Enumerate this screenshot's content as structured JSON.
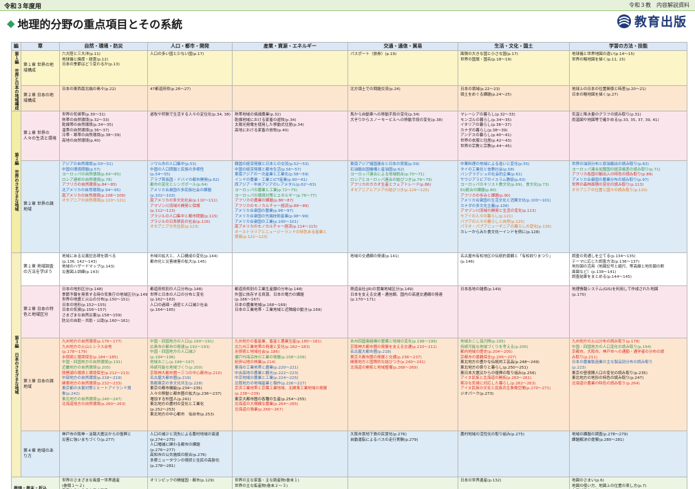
{
  "header": {
    "year_label": "令和３年度用",
    "doc_label": "令和３教　内容解説資料",
    "title": "地理的分野の重点項目とその系統",
    "title_marker": "◆",
    "publisher": "教育出版"
  },
  "columns": {
    "hen": "編",
    "sho": "章",
    "c1": "自然・環境・防災",
    "c2": "人口・都市・開発",
    "c3": "産業・資源・エネルギー",
    "c4": "交通・通信・貿易",
    "c5": "生活・文化・国土",
    "c6": "学習の方法・技能"
  },
  "hen": {
    "h1": "第１編 世界と日本の地域構成",
    "h2": "第２編 世界のさまざまな地域",
    "h3": "第３編 日本のさまざまな地域",
    "h4": "巻頭・巻末・折込"
  },
  "rows": [
    {
      "sho": "第１章 世界の地域構成",
      "c1": [
        "六大陸と三大洋(p.11)",
        "地球儀と緯度・経度(p.12)",
        "日本の季節はどう変わるか(p.13)"
      ],
      "c2": [
        "人口の多い国と少ない国(p.17)"
      ],
      "c3": [],
      "c4": [
        "パスポート（旅券）(p.19)"
      ],
      "c5": [
        "面積の大きな国と小さな国(p.17)",
        "世界の国旗・国名(p.18～19)"
      ],
      "c6": [
        "地球儀と世界地図の違い(p.14～15)",
        "世界の略地図を描く(p.11, 15)"
      ]
    },
    {
      "sho": "第２章 日本の地域構成",
      "c1": [
        "日本の東西南北端の島々(p.22)"
      ],
      "c2": [
        "47都道府県(p.26～27)"
      ],
      "c3": [],
      "c4": [
        "北方領土での問題交流(p.24)"
      ],
      "c5": [
        "日本の領域(p.22～23)",
        "領土をめぐる課題(p.24～25)"
      ],
      "c6": [
        "地球上の日本の位置関係と時差(p.20～21)",
        "日本の略地図を描く(p.27)"
      ]
    },
    {
      "sho": "第１章 世界の人々の生活と環境",
      "c1": [
        "世界の気候帯(p.30～31)",
        "熱帯の自然環境(p.32～33)",
        "乾燥帯の自然環境(p.34～35)",
        "温帯の自然環境(p.36～37)",
        "冷帯・寒帯の自然環境(p.38～39)",
        "高地の自然環境(p.40)"
      ],
      "c2": [
        "遊牧や狩猟で生活する人々の定住化(p.34, 38)"
      ],
      "c3": [
        "熱帯地域の焼畑農業(p.32)",
        "乾燥地域における家畜の遊牧(p.34)",
        "太陽光発電を使用した移動式住居(p.34)",
        "高地における家畜の放牧(p.40)"
      ],
      "c4": [
        "馬から自動車への移動手段の変化(p.34)",
        "犬ぞりからスノーモービルへの移動手段の変化(p.38)"
      ],
      "c5": [
        "マレーシアの暮らし(p.32～33)",
        "モンゴルの暮らし(p.34～35)",
        "イタリアの暮らし(p.36～37)",
        "カナダの暮らし(p.38～39)",
        "アンデスの暮らし(p.40～41)",
        "世界の衣服と住居(p.42～43)",
        "世界の宗教と宗教(p.44～45)"
      ],
      "c6": [
        "気温と降水量のグラフの読み取り(p.31)",
        "雨温図や地図等で確かめる(p.33, 35, 37, 39, 41)"
      ]
    },
    {
      "sho": "第２章 世界の諸地域",
      "c1": [
        {
          "t": "アジアの自然環境(p.50～51)",
          "c": "blue"
        },
        {
          "t": "中国の環境問題(p.57)",
          "c": "blue"
        },
        {
          "t": "ヨーロッパの自然環境(p.64～65)",
          "c": "green"
        },
        {
          "t": "ロシア連邦の自然環境(p.78)",
          "c": "green"
        },
        {
          "t": "アフリカの自然環境(p.84～85)",
          "c": "red"
        },
        {
          "t": "北アメリカの自然環境(p.94～95)",
          "c": "blue"
        },
        {
          "t": "南アメリカの自然環境(p.108～109)",
          "c": "red"
        },
        {
          "t": "オセアニアの自然環境(p.120～121)",
          "c": "orange"
        }
      ],
      "c2": [
        {
          "t": "ソウル市の人口集中(p.53)",
          "c": "blue"
        },
        {
          "t": "中国の人口問題と民族の多様性",
          "c": "blue"
        },
        {
          "t": "(p.54～55)",
          "c": "blue"
        },
        {
          "t": "アラブ首長国・ドバイの都市開発(p.62)",
          "c": "blue"
        },
        {
          "t": "都市の変化とシンガポール(p.64)",
          "c": "green"
        },
        {
          "t": "アメリカ合衆国の多民族社会の課題",
          "c": "blue"
        },
        {
          "t": "(p.102～103)",
          "c": "blue"
        },
        {
          "t": "南アメリカの多文化社会(p.110～111)",
          "c": "red"
        },
        {
          "t": "アマゾン川流域の開発と保護",
          "c": "red"
        },
        {
          "t": "(p.112～113)",
          "c": "red"
        },
        {
          "t": "ブラジルの人口集中と都市問題(p.115)",
          "c": "red"
        },
        {
          "t": "ブラジルの日系移民の社会(p.116)",
          "c": "red"
        },
        {
          "t": "オセアニアの先住民(p.123)",
          "c": "orange"
        }
      ],
      "c3": [
        {
          "t": "韓国の経済発展と日本との交流(p.52～53)",
          "c": "blue"
        },
        {
          "t": "中国の経済発展と都市生活(p.56～57)",
          "c": "blue"
        },
        {
          "t": "東南アジアの一次産業と工業化(p.58～59)",
          "c": "blue"
        },
        {
          "t": "インドの農業・工業とICT産業(p.60～61)",
          "c": "blue"
        },
        {
          "t": "西アジア・中央アジアのレアメタル(p.62～63)",
          "c": "blue"
        },
        {
          "t": "ヨーロッパの農業と工業(p.72～75)",
          "c": "green"
        },
        {
          "t": "ヨーロッパの環境対策とエネルギー(p.76～77)",
          "c": "green"
        },
        {
          "t": "アフリカの農業の課題(p.86～87)",
          "c": "red"
        },
        {
          "t": "アフリカのモノカルチャー経済(p.88～89)",
          "c": "red"
        },
        {
          "t": "アメリカ合衆国の農業(p.96～97)",
          "c": "blue"
        },
        {
          "t": "アメリカ合衆国の先端技術産業(p.98～99)",
          "c": "blue"
        },
        {
          "t": "アメリカ合衆国の工業(p.100～101)",
          "c": "blue"
        },
        {
          "t": "南アメリカのモノカルチャー経済(p.114～115)",
          "c": "red"
        },
        {
          "t": "オーストラリアとニュージーランドの特色ある産業と",
          "c": "orange"
        },
        {
          "t": "貿易(p.122～123)",
          "c": "orange"
        }
      ],
      "c4": [
        {
          "t": "東南アジア諸国連合と日本の貿易(p.59)",
          "c": "blue"
        },
        {
          "t": "石油輸出国機構と産油国(p.62)",
          "c": "blue"
        },
        {
          "t": "ヨーロッパ連合による地域統合(p.70～71)",
          "c": "green"
        },
        {
          "t": "ロシアとヨーロッパ連合の結びつき(p.79～79)",
          "c": "green"
        },
        {
          "t": "アフリカのカカオ生産とフェアトレード(p.86)",
          "c": "red"
        },
        {
          "t": "オセアニアとアジアの結びつき(p.124～125)",
          "c": "orange"
        }
      ],
      "c5": [
        {
          "t": "中華料理の地域による違いと変化(p.55)",
          "c": "blue"
        },
        {
          "t": "タイの工業化と信教社会(p.58)",
          "c": "blue"
        },
        {
          "t": "バングラデシュの社会的企業(p.61)",
          "c": "blue"
        },
        {
          "t": "サウジアラビアのイスラム教徒(p.63)",
          "c": "blue"
        },
        {
          "t": "ヨーロッパのキリスト教文化(p.69)、食文化(p.73)",
          "c": "green"
        },
        {
          "t": "EU統合の課題(p.80)",
          "c": "green"
        },
        {
          "t": "アフリカの歩みと課題(p.90)",
          "c": "red"
        },
        {
          "t": "アメリカ合衆国の生活文化と消費文化(p.100～101)",
          "c": "blue"
        },
        {
          "t": "カナダの多文化主義(p.106)",
          "c": "blue"
        },
        {
          "t": "アマゾン川流域の開発と生活の変化(p.113)",
          "c": "red"
        },
        {
          "t": "モアイの人々の暮らし(p.121)",
          "c": "orange"
        },
        {
          "t": "パプアの人々の暮らしと自然(p.125)",
          "c": "orange"
        },
        {
          "t": "パラオ・パプアニューギニアの暮らしの変化(p.126)",
          "c": "orange"
        },
        {
          "t": "カレーからみた食文化一インドを例に(p.128)",
          "c": "black"
        }
      ],
      "c6": [
        {
          "t": "世界の油田分布と原油輸出の読み取り(p.63)",
          "c": "blue"
        },
        {
          "t": "ヨーロッパ連合加盟国の経済格差の読み取り(p.71)",
          "c": "green"
        },
        {
          "t": "アフリカ各国の輸出入の特色の読み取り(p.89)",
          "c": "red"
        },
        {
          "t": "アメリカ合衆国の農業分布の読み取り(p.97)",
          "c": "blue"
        },
        {
          "t": "世界の森林面積の変化の読み取り(p.113)",
          "c": "red"
        },
        {
          "t": "オセアニアの位置と国々の読み取り(p.120)",
          "c": "orange"
        }
      ]
    },
    {
      "sho": "第１章 地域調査の方法を学ぼう",
      "c1": [
        "地域にある災害記念碑を調べる",
        "(p.136, 142～143)",
        "地域のハザードマップ(p.143)",
        "災害図上訓練(p.143)"
      ],
      "c2": [
        "市域の拡大と、人口構成の変化(p.144)",
        "都市化と災害被害の拡大(p.145)"
      ],
      "c3": [],
      "c4": [
        "地域の交通網の発達(p.141)"
      ],
      "c5": [
        "名古屋市有松地区の伝統的景観と「有松絞りまつり」",
        "(p.146)"
      ],
      "c6": [
        "調査の見通しを立てる(p.134～135)",
        "テーマに応じた調査方法(p.136～137)",
        "地形図の活用（地図記号と縮尺、等高線と地形図の断",
        "面図など）(p.138～141)",
        "調査結果をまとめる(p.144～145)"
      ]
    },
    {
      "sho": "第２章 日本の特色と地域区分",
      "c1": [
        "日本の地形区分(p.148)",
        "季節予報を発表する時の気象庁の地域区分(p.149)",
        "世界の地震と火山の分布(p.150～151)",
        "日本の地形(p.152～155)",
        "日本の気候(p.156～157)",
        "さまざまな自然災害(p.158～159)",
        "防災の自助・共助・公助(p.160～161)"
      ],
      "c2": [
        "都道府県別の人口分布(p.148)",
        "世界と日本の人口の分布と変化",
        "(p.162～163)",
        "人口の過疎・過密と人口減少社会",
        "(p.164～165)"
      ],
      "c3": [
        "都道府県別の工業生産額の分布(p.148)",
        "外国に依存する資源、日本の電力の課題",
        "(p.166～167)",
        "日本の農業地域(p.168～169)",
        "日本の工業地帯・工業地域と近隣諸の動き(p.169)"
      ],
      "c4": [
        "鉄道会社(JR)の営業地域区分(p.149)",
        "日本を支える交通・通信網、国内の高速交通網の発達",
        "(p.170～171)"
      ],
      "c5": [
        "日本各地の雑煮(p.149)"
      ],
      "c6": [
        "地理情報システム(GIS)を利用して作成された地図",
        "(p.170)"
      ]
    },
    {
      "sho": "第３章 日本の諸地域",
      "c1": [
        {
          "t": "九州地方の自然環境(p.176～177)",
          "c": "red"
        },
        {
          "t": "九州地方の火山とシラス台地",
          "c": "red"
        },
        {
          "t": "(p.178～179)",
          "c": "red"
        },
        {
          "t": "水俣病と環境保全(p.184～185)",
          "c": "red"
        },
        {
          "t": "中国・四国地方の自然環境(p.191)",
          "c": "green"
        },
        {
          "t": "近畿地方の自然環境(p.205)",
          "c": "green"
        },
        {
          "t": "琵琶湖の環境と環境保全(p.212～213)",
          "c": "red"
        },
        {
          "t": "中部地方の自然環境(p.218～219)",
          "c": "blue"
        },
        {
          "t": "関東地方の自然環境(p.232～233)",
          "c": "red"
        },
        {
          "t": "東京都の水害対策とヒートアイランド現",
          "c": "blue"
        },
        {
          "t": "象(p.242)",
          "c": "blue"
        },
        {
          "t": "東北地方の自然環境(p.246～247)",
          "c": "green"
        },
        {
          "t": "北海道地方の自然環境(p.260～263)",
          "c": "red"
        }
      ],
      "c2": [
        {
          "t": "中国・四国地方の人口(p.190～191)",
          "c": "green"
        },
        {
          "t": "広島市の都市の発達(p.192～193)",
          "c": "green"
        },
        {
          "t": "中国・四国地方の人口減少",
          "c": "green"
        },
        {
          "t": "(p.194～196)",
          "c": "green"
        },
        {
          "t": "地域おこし(p.196～197)",
          "c": "green"
        },
        {
          "t": "持続可能な地域づくり(p.200)",
          "c": "green"
        },
        {
          "t": "京阪神大都市圏ー三つの中心都市(p.210)",
          "c": "red"
        },
        {
          "t": "名古屋大都市圏(p.219)",
          "c": "blue"
        },
        {
          "t": "首都東京の多文化共生(p.228)",
          "c": "blue"
        },
        {
          "t": "東京の都市機能(p.234～235)",
          "c": "black"
        },
        {
          "t": "人々の移動と都市圏の拡大(p.236～237)",
          "c": "black"
        },
        {
          "t": "増加する外国人(p.241)",
          "c": "black"
        },
        {
          "t": "東北地方の農村の変化と工業化",
          "c": "black"
        },
        {
          "t": "(p.252～253)",
          "c": "black"
        },
        {
          "t": "東北地方の中心都市　仙台市(p.253)",
          "c": "black"
        }
      ],
      "c3": [
        {
          "t": "九州地方の畜産業、畜産と農業生産(p.180～181)",
          "c": "red"
        },
        {
          "t": "北九州工業地帯の発達と変化(p.182～183)",
          "c": "red"
        },
        {
          "t": "水俣病と地域社会(p.186)",
          "c": "red"
        },
        {
          "t": "瀬戸内海沿岸の工業の発展(p.208～209)",
          "c": "green"
        },
        {
          "t": "紀伊山地の林業(p.214)",
          "c": "red"
        },
        {
          "t": "東海の工業地帯と農業(p.220～221)",
          "c": "blue"
        },
        {
          "t": "中央高地の農業と観光(p.222～223)",
          "c": "blue"
        },
        {
          "t": "中京地域の農業と工業(p.224～225)",
          "c": "blue"
        },
        {
          "t": "北陸地方の地場産業と稲作(p.226～227)",
          "c": "blue"
        },
        {
          "t": "京浜工業地帯と京葉工業地域、北関東工業地域の発展",
          "c": "red"
        },
        {
          "t": "(p.238～239)",
          "c": "red"
        },
        {
          "t": "東京大都市圏の各種の生産(p.254～255)",
          "c": "black"
        },
        {
          "t": "北海道の大規模な農業(p.264～265)",
          "c": "red"
        },
        {
          "t": "北海道の漁業(p.266～267)",
          "c": "red"
        }
      ],
      "c4": [
        {
          "t": "本州四国連絡橋の整備と地域の変化(p.198～199)",
          "c": "green"
        },
        {
          "t": "京阪神大都市圏の発展を支える交通(p.210～211)",
          "c": "red"
        },
        {
          "t": "名古屋大都市圏(p.218)",
          "c": "blue"
        },
        {
          "t": "東京大都市圏の発展と交通(p.236～237)",
          "c": "red"
        },
        {
          "t": "関東地方と国際的な結びつき(p.240～241)",
          "c": "red"
        },
        {
          "t": "北海道の開拓と地域整備(p.268～269)",
          "c": "red"
        }
      ],
      "c5": [
        {
          "t": "地域おこし協力隊(p.195)",
          "c": "green"
        },
        {
          "t": "持続可能な地域づくりを考える(p.200)",
          "c": "green"
        },
        {
          "t": "都内地域の歴史(p.204～205)",
          "c": "red"
        },
        {
          "t": "京都市の景観保全(p.206～207)",
          "c": "red"
        },
        {
          "t": "東北地方の豊かな伝統的工芸品(p.248～249)",
          "c": "black"
        },
        {
          "t": "東北地方の祭りと暮らし(p.250～251)",
          "c": "black"
        },
        {
          "t": "東日本大震災からの復興の取り組み(p.256)",
          "c": "black"
        },
        {
          "t": "アイヌ民族と北海道の開拓(p.260～261)",
          "c": "red"
        },
        {
          "t": "寒冷な気候に対応した暮らし(p.262～263)",
          "c": "red"
        },
        {
          "t": "アイヌ民族の文化と民族共生象徴空間(p.270～271)",
          "c": "red"
        },
        {
          "t": "ジオパーク(p.273)",
          "c": "black"
        }
      ],
      "c6": [
        {
          "t": "九州地方の火山分布の読み取り(p.178)",
          "c": "red"
        },
        {
          "t": "中国・四国地方の人口変化の読み取り(p.194)",
          "c": "green"
        },
        {
          "t": "京都市、大阪市、神戸市への通勤・通学者の分布の読",
          "c": "red"
        },
        {
          "t": "み取り(p.211)",
          "c": "red"
        },
        {
          "t": "日本の農業製造業の主な製品別分布の読み取り",
          "c": "blue"
        },
        {
          "t": "(p.223)",
          "c": "blue"
        },
        {
          "t": "東京の昼夜間人口の変化の読み取り(p.235)",
          "c": "black"
        },
        {
          "t": "東北地方の地形の特色の読み取り(p.247)",
          "c": "black"
        },
        {
          "t": "北海道の農業の特色の読み取り(p.264)",
          "c": "red"
        }
      ]
    },
    {
      "sho": "第４章 地域のあり方",
      "c1": [
        "神戸市の阪神・淡路大震災からの復興と",
        "災害に強いまちづくり(p.277)"
      ],
      "c2": [
        "人口の減少と流失による農村地域の衰退",
        "(p.274～275)",
        "人口増減に関わる都市の課題",
        "(p.276～277)",
        "高知市の公共施設の統合(p.276)",
        "多摩ニュータウンの現状と住民の高齢化",
        "(p.278～281)"
      ],
      "c3": [],
      "c4": [
        "大阪市営地下鉄の民営化(p.276)",
        "自動運転によるバスの走行実験(p.279)"
      ],
      "c5": [
        "農村地域の活性化の取り組み(p.275)"
      ],
      "c6": [
        "地域の課題の調査(p.278～279)",
        "課題解決の提案(p.280～281)"
      ]
    },
    {
      "sho": "巻頭・巻末・折込",
      "c1": [
        "世界のさまざまな風景ー世界遺産",
        "(巻頭１～２)",
        "宇宙からとらえた日本列島(p.130～131)"
      ],
      "c2": [
        "オリンピックの開催国・都市(p.129)"
      ],
      "c3": [
        "世界の主な家畜・主な穀産物(巻末１)",
        "世界の主な鉱産物(巻末２～３)"
      ],
      "c4": [],
      "c5": [
        "日本の世界遺産(p.132)"
      ],
      "c6": [
        "地図のさまい(p.6)",
        "地図の使い方、地図上の位置の表し方(p.7)",
        "人口ピラミッド(p.8)"
      ]
    }
  ],
  "colors": {
    "accent_green": "#2f9e5b",
    "brand_blue": "#1e3a7a",
    "header_blue": "#dbe7f4"
  },
  "icons": {
    "logo": "kyoiku-shuppan-logo-icon"
  }
}
